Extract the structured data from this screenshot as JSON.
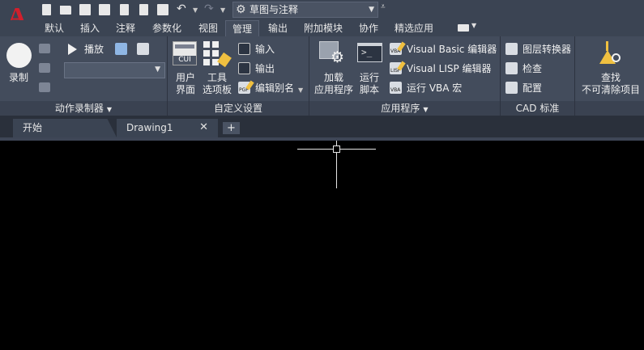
{
  "app": {
    "logo_letter": "A"
  },
  "quick_access": {
    "workspace": "草图与注释",
    "icons": [
      "new-icon",
      "open-icon",
      "save-icon",
      "save-as-icon",
      "publish-icon",
      "import-icon",
      "export-icon",
      "print-icon",
      "undo-icon",
      "redo-icon"
    ]
  },
  "ribbon_tabs": [
    {
      "label": "默认"
    },
    {
      "label": "插入"
    },
    {
      "label": "注释"
    },
    {
      "label": "参数化"
    },
    {
      "label": "视图"
    },
    {
      "label": "管理",
      "active": true
    },
    {
      "label": "输出"
    },
    {
      "label": "附加模块"
    },
    {
      "label": "协作"
    },
    {
      "label": "精选应用"
    }
  ],
  "panels": {
    "action_recorder": {
      "title": "动作录制器",
      "record": "录制",
      "play": "播放"
    },
    "customize": {
      "title": "自定义设置",
      "cui_line1": "用户",
      "cui_line2": "界面",
      "cui_icon_text": "CUI",
      "tool_line1": "工具",
      "tool_line2": "选项板",
      "import": "输入",
      "export": "输出",
      "edit_aliases": "编辑别名",
      "pgp": "PGP"
    },
    "applications": {
      "title": "应用程序",
      "load_line1": "加载",
      "load_line2": "应用程序",
      "run_line1": "运行",
      "run_line2": "脚本",
      "vba_editor": "Visual Basic 编辑器",
      "lisp_editor": "Visual LISP 编辑器",
      "run_vba": "运行 VBA 宏",
      "vba_tag": "VBA",
      "lisp_tag": "LISP",
      "prompt_glyph": ">_"
    },
    "cad_standards": {
      "title": "CAD 标准",
      "layer_translator": "图层转换器",
      "check": "检查",
      "configure": "配置"
    },
    "cleanup": {
      "find_line1": "查找",
      "find_line2": "不可清除项目"
    }
  },
  "doc_tabs": [
    {
      "label": "开始"
    },
    {
      "label": "Drawing1",
      "active": true
    }
  ],
  "colors": {
    "logo_red": "#d21f2c",
    "ribbon_bg": "#434c5c",
    "title_bg": "#3b4453",
    "canvas_bg": "#000000",
    "accent_yellow": "#f0c040"
  }
}
